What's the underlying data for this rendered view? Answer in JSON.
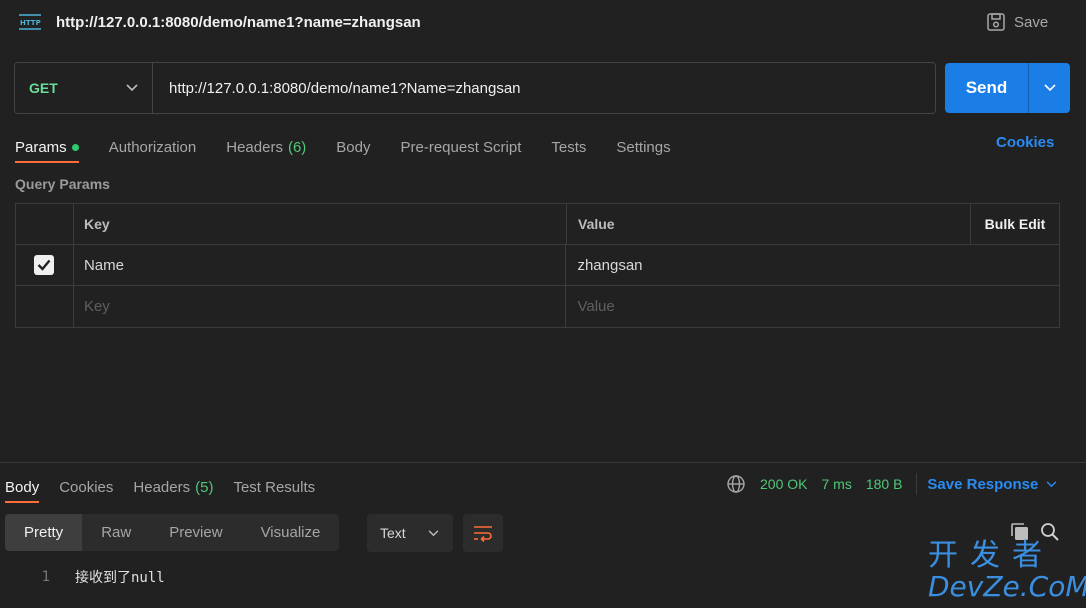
{
  "titlebar": {
    "icon": "http-icon",
    "url": "http://127.0.0.1:8080/demo/name1?name=zhangsan",
    "save_label": "Save"
  },
  "request": {
    "method": "GET",
    "url": "http://127.0.0.1:8080/demo/name1?Name=zhangsan",
    "send_label": "Send"
  },
  "request_tabs": {
    "params": "Params",
    "authorization": "Authorization",
    "headers": "Headers",
    "headers_count": "(6)",
    "body": "Body",
    "prerequest": "Pre-request Script",
    "tests": "Tests",
    "settings": "Settings",
    "cookies": "Cookies"
  },
  "query_params": {
    "label": "Query Params",
    "col_key": "Key",
    "col_value": "Value",
    "bulk_edit": "Bulk Edit",
    "rows": [
      {
        "checked": true,
        "key": "Name",
        "value": "zhangsan"
      }
    ],
    "key_placeholder": "Key",
    "value_placeholder": "Value"
  },
  "response_tabs": {
    "body": "Body",
    "cookies": "Cookies",
    "headers": "Headers",
    "headers_count": "(5)",
    "test_results": "Test Results"
  },
  "response_meta": {
    "status": "200 OK",
    "time": "7 ms",
    "size": "180 B",
    "save_response": "Save Response"
  },
  "view": {
    "pretty": "Pretty",
    "raw": "Raw",
    "preview": "Preview",
    "visualize": "Visualize",
    "format": "Text"
  },
  "code": {
    "line_number": "1",
    "content": "接收到了null"
  },
  "watermark": {
    "cn": "开发者",
    "en": "DevZe.CoM"
  },
  "colors": {
    "accent_orange": "#ff6c37",
    "send_blue": "#1a7ee6",
    "link_blue": "#2a8bf2",
    "status_green": "#4fc878",
    "method_green": "#6bdd9a"
  }
}
